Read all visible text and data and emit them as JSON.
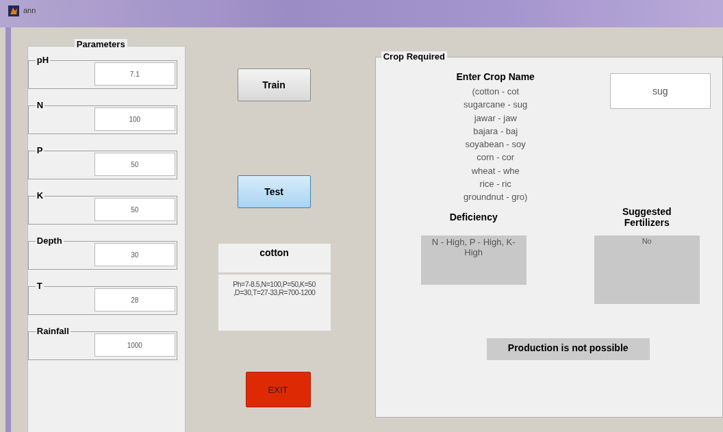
{
  "window": {
    "title": "ann"
  },
  "parameters": {
    "title": "Parameters",
    "fields": [
      {
        "label": "pH",
        "value": "7.1"
      },
      {
        "label": "N",
        "value": "100"
      },
      {
        "label": "P",
        "value": "50"
      },
      {
        "label": "K",
        "value": "50"
      },
      {
        "label": "Depth",
        "value": "30"
      },
      {
        "label": "T",
        "value": "28"
      },
      {
        "label": "Rainfall",
        "value": "1000"
      }
    ]
  },
  "actions": [
    {
      "kind": "train",
      "label": "Train"
    },
    {
      "kind": "test",
      "label": "Test"
    },
    {
      "kind": "exit",
      "label": "EXIT"
    }
  ],
  "result": {
    "crop": "cotton",
    "requirements": "Ph=7-8.5,N=100,P=50,K=50\n,D=30,T=27-33,R=700-1200"
  },
  "crop_required": {
    "title": "Crop Required",
    "prompt": "Enter Crop Name",
    "codes": "(cotton - cot\nsugarcane - sug\njawar - jaw\nbajara - baj\nsoyabean - soy\ncorn - cor\nwheat - whe\nrice - ric\ngroundnut - gro)",
    "crop_code": "sug",
    "deficiency_label": "Deficiency",
    "deficiency": "N - High, P - High, K-\nHigh",
    "fertilizer_label": "Suggested\nFertilizers",
    "fertilizer": "No",
    "verdict": "Production is not possible"
  }
}
